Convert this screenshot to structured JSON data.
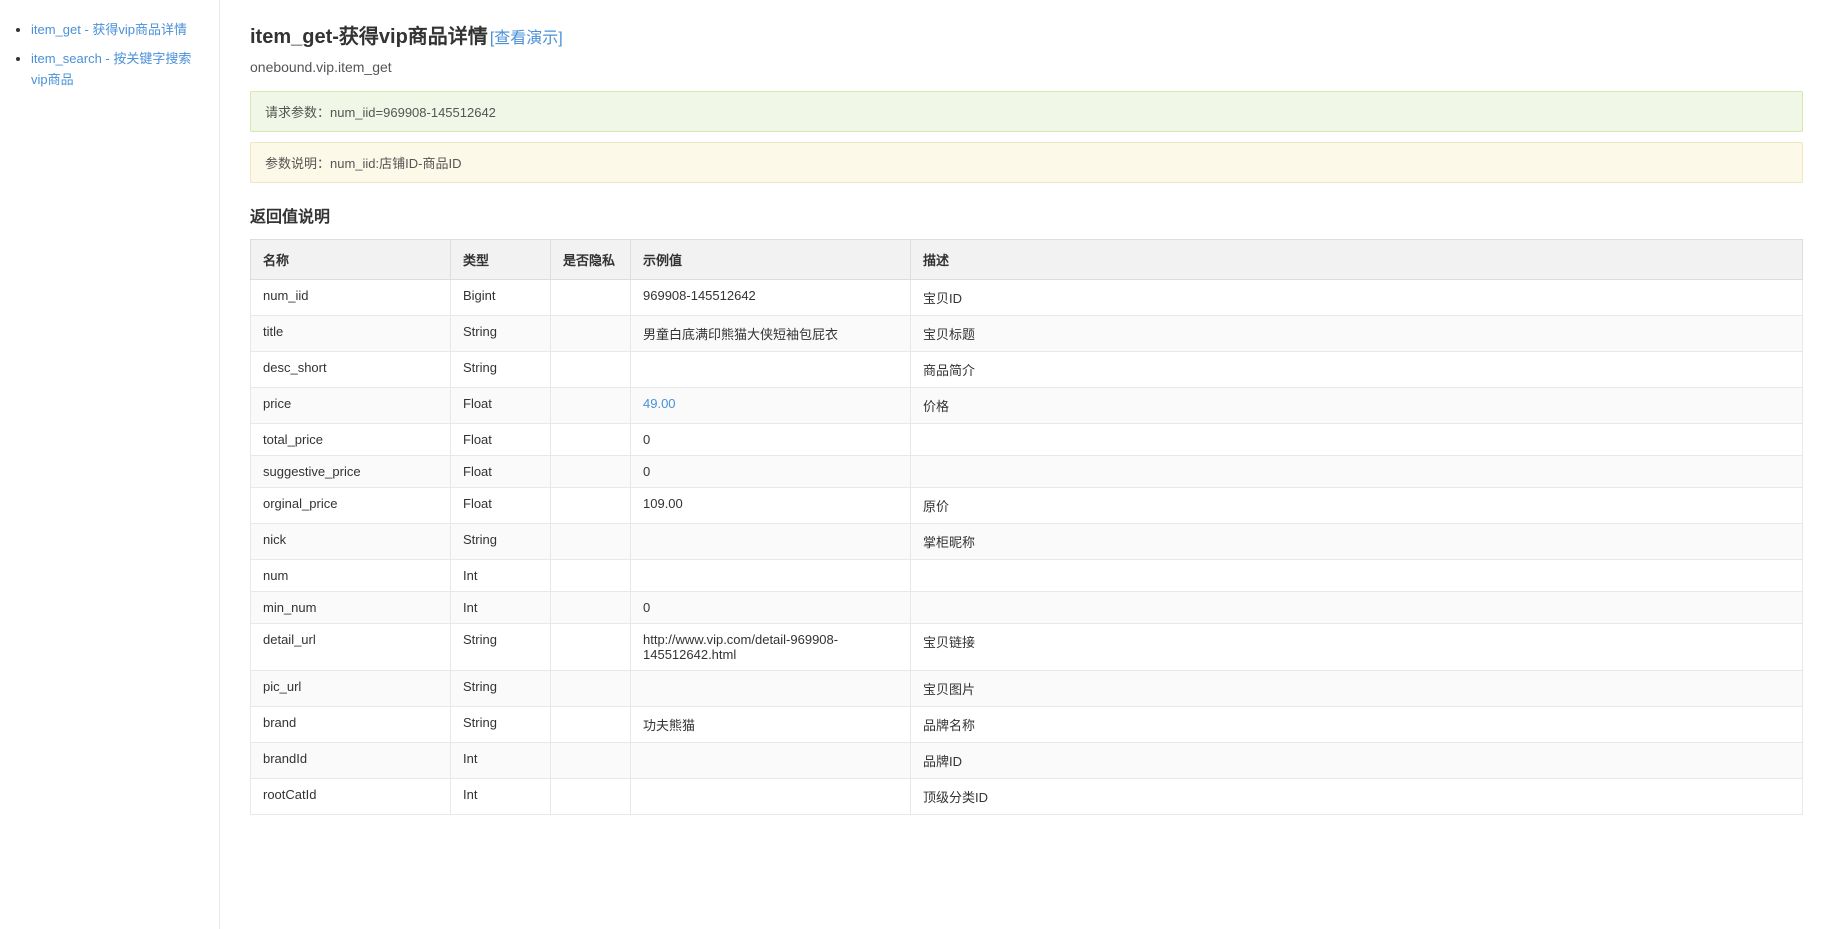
{
  "sidebar": {
    "items": [
      {
        "id": "item_get",
        "label": "item_get - 获得vip商品详情",
        "href": "#item_get"
      },
      {
        "id": "item_search",
        "label": "item_search - 按关键字搜索vip商品",
        "href": "#item_search"
      }
    ]
  },
  "main": {
    "title_prefix": "item_get-",
    "title_main": "获得vip商品详情",
    "title_link_label": "[查看演示]",
    "title_link_href": "#",
    "api_path": "onebound.vip.item_get",
    "request_params_label": "请求参数：",
    "request_params_value": "num_iid=969908-145512642",
    "params_desc_label": "参数说明：",
    "params_desc_value": "num_iid:店铺ID-商品ID",
    "return_value_title": "返回值说明",
    "table": {
      "headers": [
        "名称",
        "类型",
        "是否隐私",
        "示例值",
        "描述"
      ],
      "rows": [
        {
          "name": "num_iid",
          "type": "Bigint",
          "privacy": "",
          "example": "969908-145512642",
          "example_link": false,
          "desc": "宝贝ID"
        },
        {
          "name": "title",
          "type": "String",
          "privacy": "",
          "example": "男童白底满印熊猫大侠短袖包屁衣",
          "example_link": false,
          "desc": "宝贝标题"
        },
        {
          "name": "desc_short",
          "type": "String",
          "privacy": "",
          "example": "",
          "example_link": false,
          "desc": "商品简介"
        },
        {
          "name": "price",
          "type": "Float",
          "privacy": "",
          "example": "49.00",
          "example_link": true,
          "desc": "价格"
        },
        {
          "name": "total_price",
          "type": "Float",
          "privacy": "",
          "example": "0",
          "example_link": false,
          "desc": ""
        },
        {
          "name": "suggestive_price",
          "type": "Float",
          "privacy": "",
          "example": "0",
          "example_link": false,
          "desc": ""
        },
        {
          "name": "orginal_price",
          "type": "Float",
          "privacy": "",
          "example": "109.00",
          "example_link": false,
          "desc": "原价"
        },
        {
          "name": "nick",
          "type": "String",
          "privacy": "",
          "example": "",
          "example_link": false,
          "desc": "掌柜昵称"
        },
        {
          "name": "num",
          "type": "Int",
          "privacy": "",
          "example": "",
          "example_link": false,
          "desc": ""
        },
        {
          "name": "min_num",
          "type": "Int",
          "privacy": "",
          "example": "0",
          "example_link": false,
          "desc": ""
        },
        {
          "name": "detail_url",
          "type": "String",
          "privacy": "",
          "example": "http://www.vip.com/detail-969908-145512642.html",
          "example_link": false,
          "desc": "宝贝链接"
        },
        {
          "name": "pic_url",
          "type": "String",
          "privacy": "",
          "example": "",
          "example_link": false,
          "desc": "宝贝图片"
        },
        {
          "name": "brand",
          "type": "String",
          "privacy": "",
          "example": "功夫熊猫",
          "example_link": false,
          "desc": "品牌名称"
        },
        {
          "name": "brandId",
          "type": "Int",
          "privacy": "",
          "example": "",
          "example_link": false,
          "desc": "品牌ID"
        },
        {
          "name": "rootCatId",
          "type": "Int",
          "privacy": "",
          "example": "",
          "example_link": false,
          "desc": "顶级分类ID"
        }
      ]
    }
  }
}
